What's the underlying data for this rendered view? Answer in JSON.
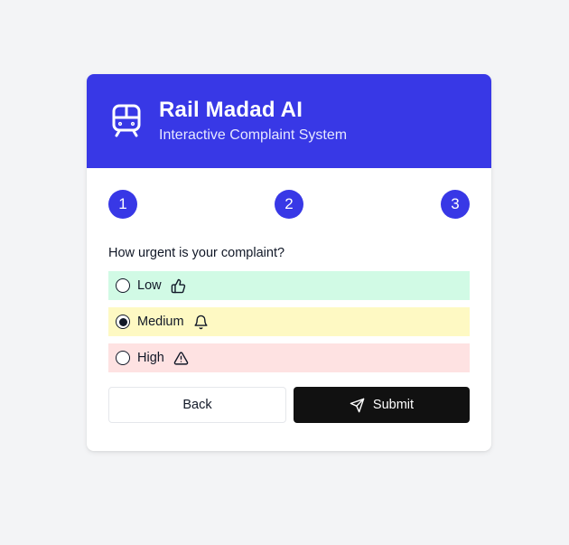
{
  "header": {
    "title": "Rail Madad AI",
    "subtitle": "Interactive Complaint System",
    "icon": "train-icon"
  },
  "steps": [
    "1",
    "2",
    "3"
  ],
  "question": "How urgent is your complaint?",
  "options": [
    {
      "label": "Low",
      "icon": "thumbs-up-icon",
      "selected": false,
      "color": "#d1fae5"
    },
    {
      "label": "Medium",
      "icon": "bell-icon",
      "selected": true,
      "color": "#fef9c3"
    },
    {
      "label": "High",
      "icon": "warning-icon",
      "selected": false,
      "color": "#fee2e2"
    }
  ],
  "actions": {
    "back_label": "Back",
    "submit_label": "Submit",
    "submit_icon": "send-icon"
  },
  "colors": {
    "accent": "#3838e6",
    "submit_bg": "#111111"
  }
}
